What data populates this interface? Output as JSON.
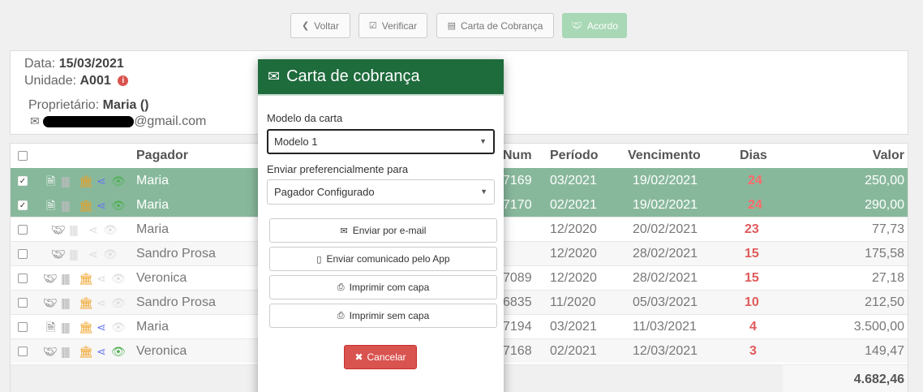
{
  "toolbar": {
    "voltar": "Voltar",
    "verificar": "Verificar",
    "carta": "Carta de Cobrança",
    "acordo": "Acordo"
  },
  "info": {
    "data_label": "Data:",
    "data_value": "15/03/2021",
    "unidade_label": "Unidade:",
    "unidade_value": "A001",
    "proprietario_label": "Proprietário:",
    "proprietario_value": "Maria ()",
    "email_suffix": "@gmail.com"
  },
  "table": {
    "headers": {
      "pagador": "Pagador",
      "num": "Num",
      "periodo": "Período",
      "vencimento": "Vencimento",
      "dias": "Dias",
      "valor": "Valor"
    },
    "rows": [
      {
        "checked": true,
        "pagador": "Maria",
        "num": "7169",
        "periodo": "03/2021",
        "vencimento": "19/02/2021",
        "dias": "24",
        "valor": "250,00"
      },
      {
        "checked": true,
        "pagador": "Maria",
        "num": "7170",
        "periodo": "02/2021",
        "vencimento": "19/02/2021",
        "dias": "24",
        "valor": "290,00"
      },
      {
        "checked": false,
        "pagador": "Maria",
        "num": "",
        "periodo": "12/2020",
        "vencimento": "20/02/2021",
        "dias": "23",
        "valor": "77,73"
      },
      {
        "checked": false,
        "pagador": "Sandro Prosa",
        "num": "",
        "periodo": "12/2020",
        "vencimento": "28/02/2021",
        "dias": "15",
        "valor": "175,58"
      },
      {
        "checked": false,
        "pagador": "Veronica",
        "num": "7089",
        "periodo": "12/2020",
        "vencimento": "28/02/2021",
        "dias": "15",
        "valor": "27,18"
      },
      {
        "checked": false,
        "pagador": "Sandro Prosa",
        "num": "6835",
        "periodo": "11/2020",
        "vencimento": "05/03/2021",
        "dias": "10",
        "valor": "212,50"
      },
      {
        "checked": false,
        "pagador": "Maria",
        "num": "7194",
        "periodo": "03/2021",
        "vencimento": "11/03/2021",
        "dias": "4",
        "valor": "3.500,00"
      },
      {
        "checked": false,
        "pagador": "Veronica",
        "num": "7168",
        "periodo": "02/2021",
        "vencimento": "12/03/2021",
        "dias": "3",
        "valor": "149,47"
      }
    ],
    "total": "4.682,46"
  },
  "modal": {
    "title": "Carta de cobrança",
    "modelo_label": "Modelo da carta",
    "modelo_value": "Modelo 1",
    "enviar_label": "Enviar preferencialmente para",
    "enviar_value": "Pagador Configurado",
    "btn_email": "Enviar por e-mail",
    "btn_app": "Enviar comunicado pelo App",
    "btn_com_capa": "Imprimir com capa",
    "btn_sem_capa": "Imprimir sem capa",
    "btn_cancelar": "Cancelar"
  },
  "colors": {
    "modal_header": "#1e6b3c",
    "selected_row": "#88b89c",
    "cancel": "#d9534f",
    "acordo": "#a8d8b5"
  }
}
